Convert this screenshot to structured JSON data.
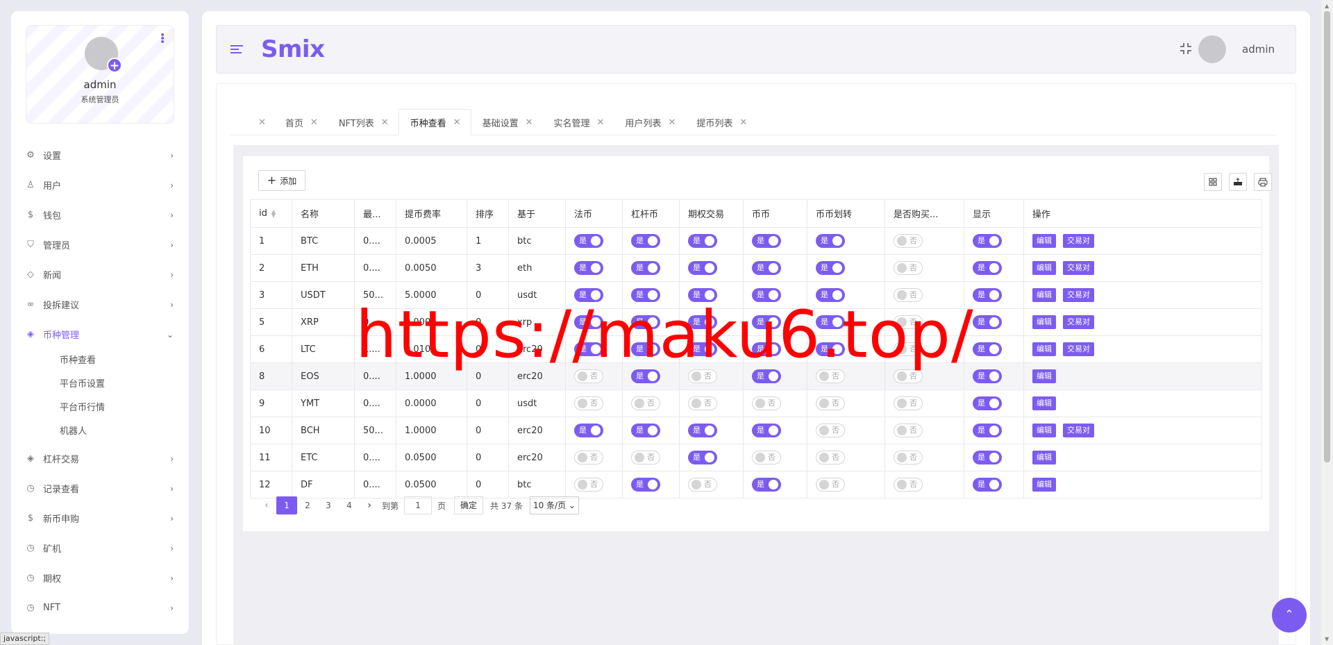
{
  "profile": {
    "name": "admin",
    "role": "系统管理员"
  },
  "menu": [
    {
      "label": "设置",
      "icon": "gear-icon",
      "glyph": "⚙"
    },
    {
      "label": "用户",
      "icon": "user-icon",
      "glyph": "♙"
    },
    {
      "label": "钱包",
      "icon": "wallet-icon",
      "glyph": "$"
    },
    {
      "label": "管理员",
      "icon": "shield-icon",
      "glyph": "⛉"
    },
    {
      "label": "新闻",
      "icon": "tag-icon",
      "glyph": "◇"
    },
    {
      "label": "投拆建议",
      "icon": "infinity-icon",
      "glyph": "∞"
    },
    {
      "label": "币种管理",
      "icon": "diamond-icon",
      "glyph": "◈"
    }
  ],
  "submenu": [
    "币种查看",
    "平台币设置",
    "平台币行情",
    "机器人"
  ],
  "menu2": [
    {
      "label": "杠杆交易",
      "icon": "diamond-icon",
      "glyph": "◈"
    },
    {
      "label": "记录查看",
      "icon": "clock-icon",
      "glyph": "◷"
    },
    {
      "label": "新币申购",
      "icon": "dollar-icon",
      "glyph": "$"
    },
    {
      "label": "矿机",
      "icon": "clock-icon",
      "glyph": "◷"
    },
    {
      "label": "期权",
      "icon": "clock-icon",
      "glyph": "◷"
    },
    {
      "label": "NFT",
      "icon": "clock-icon",
      "glyph": "◷"
    }
  ],
  "brand": "Smix",
  "top_user": "admin",
  "tabs": [
    "首页",
    "NFT列表",
    "币种查看",
    "基础设置",
    "实名管理",
    "用户列表",
    "提币列表"
  ],
  "active_tab": "币种查看",
  "toolbar": {
    "add_label": "添加"
  },
  "table": {
    "headers": [
      "id",
      "名称",
      "最...",
      "提币费率",
      "排序",
      "基于",
      "法币",
      "杠杆币",
      "期权交易",
      "币币",
      "币币划转",
      "是否购买...",
      "显示",
      "操作"
    ],
    "rows": [
      {
        "id": "1",
        "name": "BTC",
        "min": "0....",
        "fee": "0.0005",
        "sort": "1",
        "base": "btc",
        "fiat": true,
        "lever": true,
        "option": true,
        "coin": true,
        "transfer": true,
        "buy": false,
        "show": true,
        "pair": true
      },
      {
        "id": "2",
        "name": "ETH",
        "min": "0....",
        "fee": "0.0050",
        "sort": "3",
        "base": "eth",
        "fiat": true,
        "lever": true,
        "option": true,
        "coin": true,
        "transfer": true,
        "buy": false,
        "show": true,
        "pair": true
      },
      {
        "id": "3",
        "name": "USDT",
        "min": "50...",
        "fee": "5.0000",
        "sort": "0",
        "base": "usdt",
        "fiat": true,
        "lever": true,
        "option": true,
        "coin": true,
        "transfer": true,
        "buy": false,
        "show": true,
        "pair": true
      },
      {
        "id": "5",
        "name": "XRP",
        "min": "0....",
        "fee": "0.0000",
        "sort": "0",
        "base": "xrp",
        "fiat": true,
        "lever": true,
        "option": true,
        "coin": true,
        "transfer": true,
        "buy": false,
        "show": true,
        "pair": true
      },
      {
        "id": "6",
        "name": "LTC",
        "min": "1....",
        "fee": "0.0100",
        "sort": "0",
        "base": "erc20",
        "fiat": true,
        "lever": true,
        "option": true,
        "coin": true,
        "transfer": true,
        "buy": false,
        "show": true,
        "pair": true
      },
      {
        "id": "8",
        "name": "EOS",
        "min": "0....",
        "fee": "1.0000",
        "sort": "0",
        "base": "erc20",
        "fiat": false,
        "lever": true,
        "option": false,
        "coin": true,
        "transfer": false,
        "buy": false,
        "show": true,
        "pair": false
      },
      {
        "id": "9",
        "name": "YMT",
        "min": "0....",
        "fee": "0.0000",
        "sort": "0",
        "base": "usdt",
        "fiat": false,
        "lever": false,
        "option": false,
        "coin": false,
        "transfer": false,
        "buy": false,
        "show": true,
        "pair": false
      },
      {
        "id": "10",
        "name": "BCH",
        "min": "50...",
        "fee": "1.0000",
        "sort": "0",
        "base": "erc20",
        "fiat": true,
        "lever": true,
        "option": true,
        "coin": true,
        "transfer": false,
        "buy": false,
        "show": true,
        "pair": true
      },
      {
        "id": "11",
        "name": "ETC",
        "min": "0....",
        "fee": "0.0500",
        "sort": "0",
        "base": "erc20",
        "fiat": false,
        "lever": false,
        "option": true,
        "coin": false,
        "transfer": false,
        "buy": false,
        "show": true,
        "pair": false
      },
      {
        "id": "12",
        "name": "DF",
        "min": "0....",
        "fee": "0.0500",
        "sort": "0",
        "base": "btc",
        "fiat": false,
        "lever": true,
        "option": false,
        "coin": true,
        "transfer": false,
        "buy": false,
        "show": true,
        "pair": false
      }
    ],
    "on_label": "是",
    "off_label": "否",
    "edit_label": "编辑",
    "pair_label": "交易对"
  },
  "pager": {
    "pages": [
      "1",
      "2",
      "3",
      "4"
    ],
    "current": "1",
    "goto_label": "到第",
    "goto_value": "1",
    "page_unit": "页",
    "ok_label": "确定",
    "total": "共 37 条",
    "size": "10 条/页"
  },
  "watermark": "https://maku6.top/",
  "status_text": "javascript:;",
  "colors": {
    "accent": "#7c5cf0"
  }
}
